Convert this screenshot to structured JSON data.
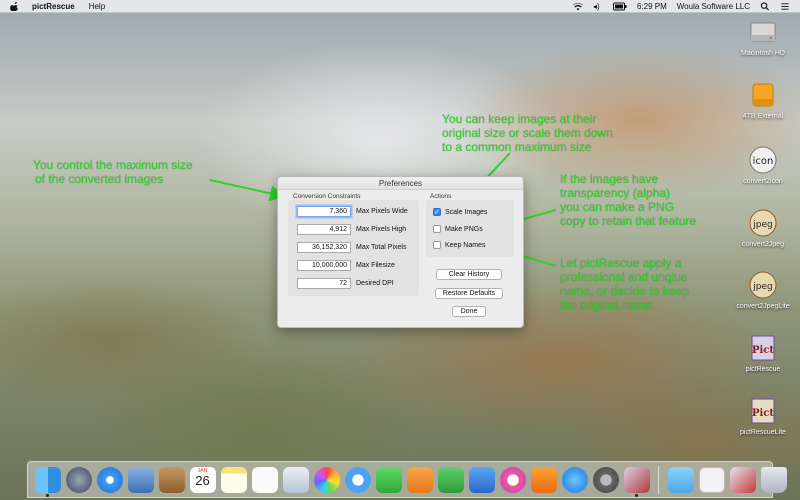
{
  "menubar": {
    "app_name": "pictRescue",
    "menus": [
      "Help"
    ],
    "time": "6:29 PM",
    "vendor": "Woula Software LLC"
  },
  "window": {
    "title": "Preferences",
    "constraints_label": "Conversion Constraints",
    "actions_label": "Actions",
    "fields": [
      {
        "value": "7,360",
        "label": "Max Pixels Wide"
      },
      {
        "value": "4,912",
        "label": "Max Pixels High"
      },
      {
        "value": "36,152,320",
        "label": "Max Total Pixels"
      },
      {
        "value": "10,000,000",
        "label": "Max Filesize"
      },
      {
        "value": "72",
        "label": "Desired DPI"
      }
    ],
    "checkboxes": [
      {
        "label": "Scale Images",
        "checked": true
      },
      {
        "label": "Make PNGs",
        "checked": false
      },
      {
        "label": "Keep Names",
        "checked": false
      }
    ],
    "buttons": {
      "clear_history": "Clear History",
      "restore_defaults": "Restore Defaults",
      "done": "Done"
    }
  },
  "annotations": {
    "size_note": [
      "You control the maximum size",
      "of the converted images"
    ],
    "scale_note": [
      "You can keep images at their",
      "original size or scale them down",
      "to a common maximum size"
    ],
    "png_note": [
      "If the images have",
      "transparency (alpha)",
      "you can make a PNG",
      "copy to retain that feature"
    ],
    "names_note": [
      "Let pictRescue apply a",
      "professional and unqiue",
      "name, or decide to keep",
      "the original name."
    ]
  },
  "desktop_icons": [
    {
      "label": "Macintosh HD",
      "icon": "hard-drive-icon"
    },
    {
      "label": "4TB External",
      "icon": "external-drive-icon"
    },
    {
      "label": "convert2icon",
      "icon": "convert2icon-app-icon",
      "badge": "icon"
    },
    {
      "label": "convert2Jpeg",
      "icon": "convert2jpeg-app-icon",
      "badge": "jpeg"
    },
    {
      "label": "convert2JpegLite",
      "icon": "convert2jpeglite-app-icon",
      "badge": "jpeg"
    },
    {
      "label": "pictRescue",
      "icon": "pictrescue-app-icon",
      "badge": "Pict"
    },
    {
      "label": "pictRescueLite",
      "icon": "pictrescuelite-app-icon",
      "badge": "Pict"
    }
  ],
  "dock": {
    "calendar_month": "JAN",
    "calendar_day": "26"
  },
  "colors": {
    "annotation": "#2fd12a",
    "checkbox_accent": "#3a87f2"
  }
}
